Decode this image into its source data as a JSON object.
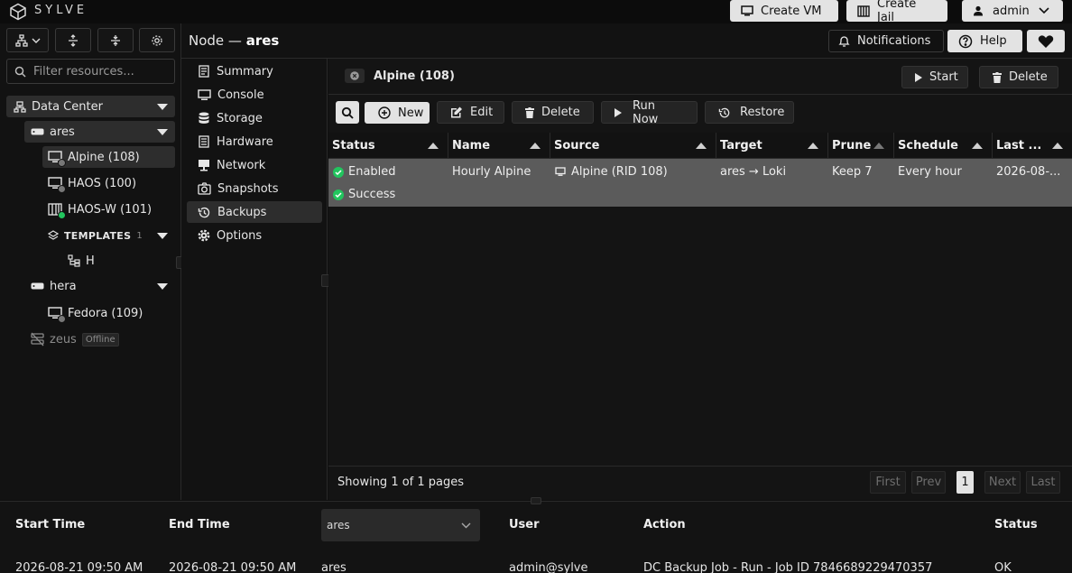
{
  "header": {
    "brand": "SYLVE",
    "create_vm": "Create VM",
    "create_jail": "Create Jail",
    "user": "admin"
  },
  "sidebar": {
    "filter_placeholder": "Filter resources...",
    "tree": {
      "datacenter": "Data Center",
      "nodes": [
        {
          "name": "ares",
          "children": [
            {
              "label": "Alpine (108)",
              "status": "stopped"
            },
            {
              "label": "HAOS (100)",
              "status": "stopped"
            },
            {
              "label": "HAOS-W (101)",
              "status": "running"
            }
          ]
        },
        {
          "name": "hera",
          "children": [
            {
              "label": "Fedora (109)",
              "status": "stopped"
            }
          ]
        },
        {
          "name": "zeus",
          "badge": "Offline"
        }
      ],
      "templates_label": "TEMPLATES",
      "templates_count": "1",
      "template_item": "H"
    }
  },
  "topbar": {
    "node_prefix": "Node —",
    "node_name": "ares",
    "notifications": "Notifications",
    "help": "Help"
  },
  "nav": {
    "items": [
      "Summary",
      "Console",
      "Storage",
      "Hardware",
      "Network",
      "Snapshots",
      "Backups",
      "Options"
    ],
    "active": "Backups"
  },
  "content": {
    "tab_title": "Alpine (108)",
    "start": "Start",
    "delete": "Delete",
    "toolbar": {
      "new": "New",
      "edit": "Edit",
      "delete": "Delete",
      "run_now": "Run Now",
      "restore": "Restore"
    },
    "columns": [
      "Status",
      "Name",
      "Source",
      "Target",
      "Prune",
      "Schedule",
      "Last ..."
    ],
    "rows": [
      {
        "status": "Enabled",
        "last_status": "Success",
        "name": "Hourly Alpine",
        "source": "Alpine (RID 108)",
        "target": "ares → Loki",
        "prune": "Keep 7",
        "schedule": "Every hour",
        "last": "2026-08-..."
      }
    ],
    "pagination": {
      "info": "Showing 1 of 1 pages",
      "first": "First",
      "prev": "Prev",
      "page": "1",
      "next": "Next",
      "last": "Last"
    }
  },
  "tasks": {
    "columns": [
      "Start Time",
      "End Time",
      "User",
      "Action",
      "Status"
    ],
    "node_filter": "ares",
    "row": {
      "start": "2026-08-21 09:50 AM",
      "end": "2026-08-21 09:50 AM",
      "node": "ares",
      "user": "admin@sylve",
      "action": "DC Backup Job - Run - Job ID 7846689229470357",
      "status": "OK"
    }
  },
  "colors": {
    "accent_green": "#22c55e",
    "selected_row": "#5b5b5b",
    "button_light": "#e3e3e3"
  }
}
